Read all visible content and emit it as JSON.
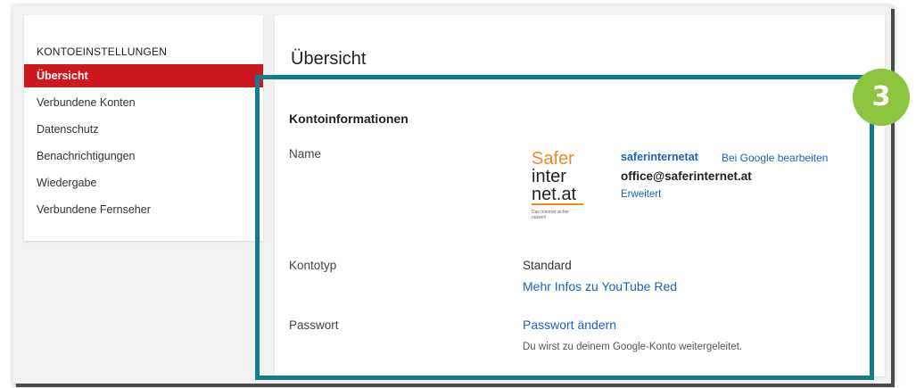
{
  "sidebar": {
    "heading": "KONTOEINSTELLUNGEN",
    "items": [
      {
        "label": "Übersicht",
        "active": true
      },
      {
        "label": "Verbundene Konten"
      },
      {
        "label": "Datenschutz"
      },
      {
        "label": "Benachrichtigungen"
      },
      {
        "label": "Wiedergabe"
      },
      {
        "label": "Verbundene Fernseher"
      }
    ]
  },
  "main": {
    "title": "Übersicht",
    "section_title": "Kontoinformationen",
    "name_label": "Name",
    "logo": {
      "line1": "Safer",
      "line2": "inter",
      "line3": "net.at",
      "tagline": "Das Internet sicher nutzen!"
    },
    "account_name": "saferinternetat",
    "edit_link": "Bei Google bearbeiten",
    "email": "office@saferinternet.at",
    "advanced_link": "Erweitert",
    "type_label": "Kontotyp",
    "type_value": "Standard",
    "type_link": "Mehr Infos zu YouTube Red",
    "password_label": "Passwort",
    "password_link": "Passwort ändern",
    "password_hint": "Du wirst zu deinem Google-Konto weitergeleitet."
  },
  "annotation": {
    "step_number": "3",
    "frame_color": "#137b8a",
    "badge_color": "#8cc63f"
  },
  "colors": {
    "active": "#cc181e",
    "link": "#1c62b9"
  }
}
